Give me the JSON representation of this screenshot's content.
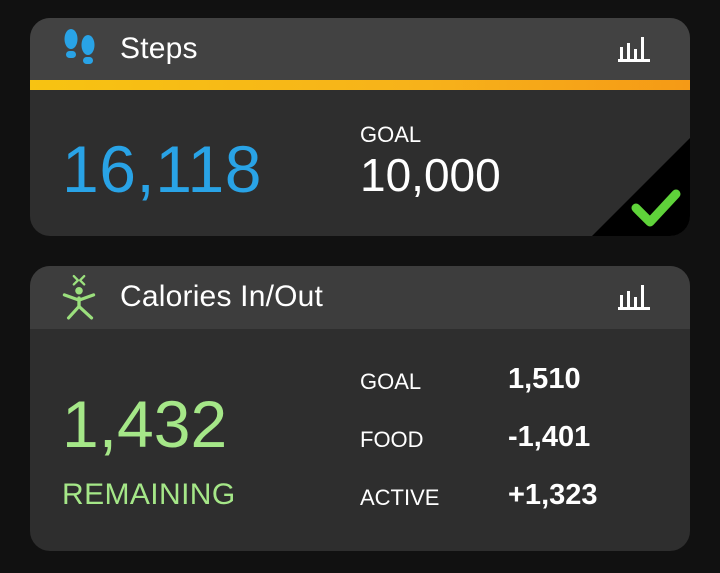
{
  "steps": {
    "title": "Steps",
    "value": "16,118",
    "goal_label": "GOAL",
    "goal_value": "10,000",
    "accent_color": "#f7c312",
    "value_color": "#29a3e6",
    "icon": "footprints-icon",
    "goal_met": true
  },
  "calories": {
    "title": "Calories In/Out",
    "remaining_value": "1,432",
    "remaining_label": "REMAINING",
    "value_color": "#a5e788",
    "icon": "myfitnesspal-figure-icon",
    "rows": [
      {
        "label": "GOAL",
        "value": "1,510"
      },
      {
        "label": "FOOD",
        "value": "-1,401"
      },
      {
        "label": "ACTIVE",
        "value": "+1,323"
      }
    ]
  }
}
